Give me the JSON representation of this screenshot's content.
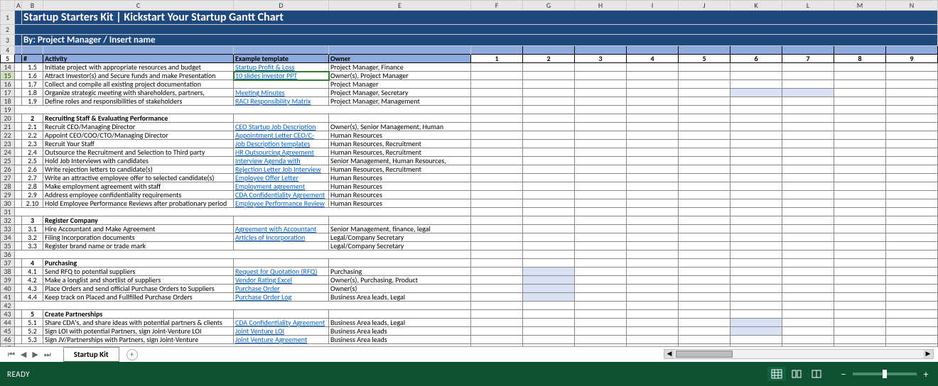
{
  "columns": [
    "A",
    "B",
    "C",
    "D",
    "E",
    "F",
    "G",
    "H",
    "I",
    "J",
    "K",
    "L",
    "M",
    "N"
  ],
  "title": "Startup Starters Kit | Kickstart Your Startup Gantt Chart",
  "byline": "By: Project Manager / Insert name",
  "headers": {
    "num": "#",
    "activity": "Activity",
    "template": "Example template",
    "owner": "Owner"
  },
  "gantt_numbers": [
    "1",
    "2",
    "3",
    "4",
    "5",
    "6",
    "7",
    "8",
    "9"
  ],
  "rows": [
    {
      "r": 14,
      "n": "1.5",
      "act": "Initiate project with appropriate resources and budget",
      "tpl": "Startup Profit & Loss",
      "tlink": true,
      "own": "Project Manager, Finance",
      "sh": []
    },
    {
      "r": 15,
      "n": "1.6",
      "act": "Attract Investor(s) and Secure funds and make Presentation",
      "tpl": "10 slides investor PPT",
      "tlink": true,
      "own": "Owner(s), Project Manager",
      "sh": [],
      "selected": true
    },
    {
      "r": 16,
      "n": "1.7",
      "act": "Collect and compile all existing project documentation",
      "tpl": "",
      "own": "Project Manager",
      "sh": []
    },
    {
      "r": 17,
      "n": "1.8",
      "act": "Organize strategic meeting with shareholders, partners,",
      "tpl": "Meeting Minutes",
      "tlink": true,
      "own": "Project Manager, Secretary",
      "sh": [
        6,
        7
      ]
    },
    {
      "r": 18,
      "n": "1.9",
      "act": "Define roles and responsibilities of stakeholders",
      "tpl": "RACI Responsibility Matrix",
      "tlink": true,
      "own": "Project Manager, Management",
      "sh": []
    },
    {
      "r": 19,
      "blank": true
    },
    {
      "r": 20,
      "n": "2",
      "act": "Recruiting Staff & Evaluating Performance",
      "bold": true,
      "tpl": "",
      "own": "",
      "sh": []
    },
    {
      "r": 21,
      "n": "2.1",
      "act": "Recruit CEO/Managing Director",
      "tpl": "CEO Startup Job Description",
      "tlink": true,
      "own": "Owner(s), Senior Management, Human",
      "sh": []
    },
    {
      "r": 22,
      "n": "2.2",
      "act": "Appoint CEO/COO/CTO/Managing Director",
      "tpl": "Appointment Letter CEO/C-",
      "tlink": true,
      "own": "Human Resources",
      "sh": []
    },
    {
      "r": 23,
      "n": "2.3",
      "act": "Recruit Your Staff",
      "tpl": "Job Description templates",
      "tlink": true,
      "own": "Human Resources, Recruitment",
      "sh": []
    },
    {
      "r": 24,
      "n": "2.4",
      "act": "Outsource the Recruitment and Selection to Third party",
      "tpl": "HR Outsourcing Agreement",
      "tlink": true,
      "own": "Human Resources, Recruitment",
      "sh": []
    },
    {
      "r": 25,
      "n": "2.5",
      "act": "Hold Job Interviews with candidates",
      "tpl": "Interview Agenda with",
      "tlink": true,
      "own": "Senior Management, Human Resources,",
      "sh": []
    },
    {
      "r": 26,
      "n": "2.6",
      "act": "Write rejection letters to candidate(s)",
      "tpl": "Rejection Letter Job Interview",
      "tlink": true,
      "own": "Human Resources, Recruitment",
      "sh": []
    },
    {
      "r": 27,
      "n": "2.7",
      "act": "Write an attractive employee offer to selected candidate(s)",
      "tpl": "Employee Offer Letter",
      "tlink": true,
      "own": "Human Resources",
      "sh": []
    },
    {
      "r": 28,
      "n": "2.8",
      "act": "Make employment agreement with staff",
      "tpl": "Employment agreement",
      "tlink": true,
      "own": "Human Resources",
      "sh": []
    },
    {
      "r": 29,
      "n": "2.9",
      "act": "Address employee confidentiality requirements",
      "tpl": "CDA Confidentiality Agreement",
      "tlink": true,
      "own": "Human Resources",
      "sh": []
    },
    {
      "r": 30,
      "n": "2.10",
      "act": "Hold Employee Performance Reviews after probationary period",
      "tpl": "Employee Performance Review",
      "tlink": true,
      "own": "Human Resources",
      "sh": []
    },
    {
      "r": 31,
      "blank": true
    },
    {
      "r": 32,
      "n": "3",
      "act": "Register Company",
      "bold": true,
      "tpl": "",
      "own": "",
      "sh": []
    },
    {
      "r": 33,
      "n": "3.1",
      "act": "Hire Accountant and Make Agreement",
      "tpl": "Agreement with Accountant",
      "tlink": true,
      "own": "Senior Management, finance, legal",
      "sh": []
    },
    {
      "r": 34,
      "n": "3.2",
      "act": "Filing Incorporation documents",
      "tpl": "Articles of Incorporation",
      "tlink": true,
      "own": "Legal/Company Secretary",
      "sh": []
    },
    {
      "r": 35,
      "n": "3.3",
      "act": "Register brand name or trade mark",
      "tpl": "",
      "own": "Legal/Company Secretary",
      "sh": []
    },
    {
      "r": 36,
      "blank": true
    },
    {
      "r": 37,
      "n": "4",
      "act": "Purchasing",
      "bold": true,
      "tpl": "",
      "own": "",
      "sh": []
    },
    {
      "r": 38,
      "n": "4.1",
      "act": "Send RFQ to potential suppliers",
      "tpl": "Request for Quotation (RFQ)",
      "tlink": true,
      "own": "Purchasing",
      "sh": [
        2
      ]
    },
    {
      "r": 39,
      "n": "4.2",
      "act": "Make a longlist and shortlist of suppliers",
      "tpl": "Vendor Rating Excel",
      "tlink": true,
      "own": "Owner(s), Purchasing, Product",
      "sh": [
        2
      ]
    },
    {
      "r": 40,
      "n": "4.3",
      "act": "Place Orders and send official Purchase Orders to Suppliers",
      "tpl": "Purchase Order",
      "tlink": true,
      "own": "Owner(s)",
      "sh": [
        2
      ]
    },
    {
      "r": 41,
      "n": "4.4",
      "act": "Keep track on Placed and Fullfilled Purchase Orders",
      "tpl": "Purchase Order Log",
      "tlink": true,
      "own": "Business Area leads, Legal",
      "sh": [
        2
      ]
    },
    {
      "r": 42,
      "blank": true
    },
    {
      "r": 43,
      "n": "5",
      "act": "Create Partnerships",
      "bold": true,
      "tpl": "",
      "own": "",
      "sh": []
    },
    {
      "r": 44,
      "n": "5.1",
      "act": "Share CDA's, and share ideas with potential partners & clients",
      "tpl": "CDA Confidentiality Agreement",
      "tlink": true,
      "own": "Business Area leads, Legal",
      "sh": [
        6
      ]
    },
    {
      "r": 45,
      "n": "5.2",
      "act": "Sign LOI with potential Partners,  sign Joint-Venture LOI",
      "tpl": "Joint Venture LOI",
      "tlink": true,
      "own": "Business Area leads",
      "sh": [
        6
      ]
    },
    {
      "r": 46,
      "n": "5.3",
      "act": "Sign JV/Partnerships with Partners,  sign Joint-Venture",
      "tpl": "Joint Venture Agreement",
      "tlink": true,
      "own": "Business Area leads",
      "sh": []
    },
    {
      "r": 47,
      "blank": true
    }
  ],
  "tab": "Startup Kit",
  "status": "READY"
}
